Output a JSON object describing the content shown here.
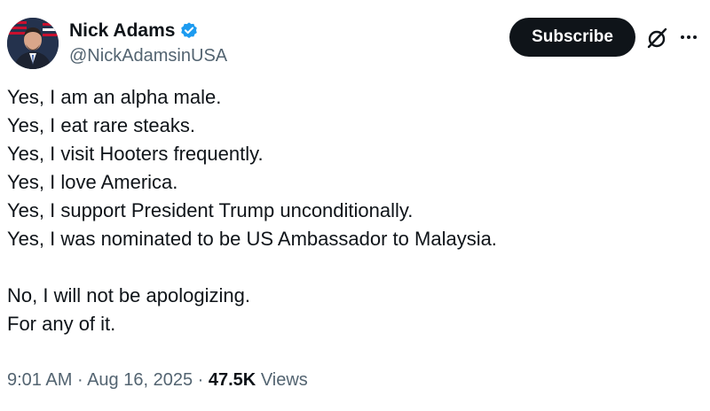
{
  "author": {
    "display_name": "Nick Adams",
    "handle": "@NickAdamsinUSA",
    "verified": true,
    "verified_color": "#1d9bf0"
  },
  "actions": {
    "subscribe_label": "Subscribe",
    "grok_icon": "grok-icon",
    "more_icon": "more-icon"
  },
  "tweet": {
    "lines": [
      "Yes, I am an alpha male.",
      "Yes, I eat rare steaks.",
      "Yes, I visit Hooters frequently.",
      "Yes, I love America.",
      "Yes, I support President Trump unconditionally.",
      "Yes, I was nominated to be US Ambassador to Malaysia.",
      "",
      "No, I will not be apologizing.",
      "For any of it."
    ]
  },
  "meta": {
    "time": "9:01 AM",
    "separator": "·",
    "date": "Aug 16, 2025",
    "views_count": "47.5K",
    "views_label": "Views"
  }
}
